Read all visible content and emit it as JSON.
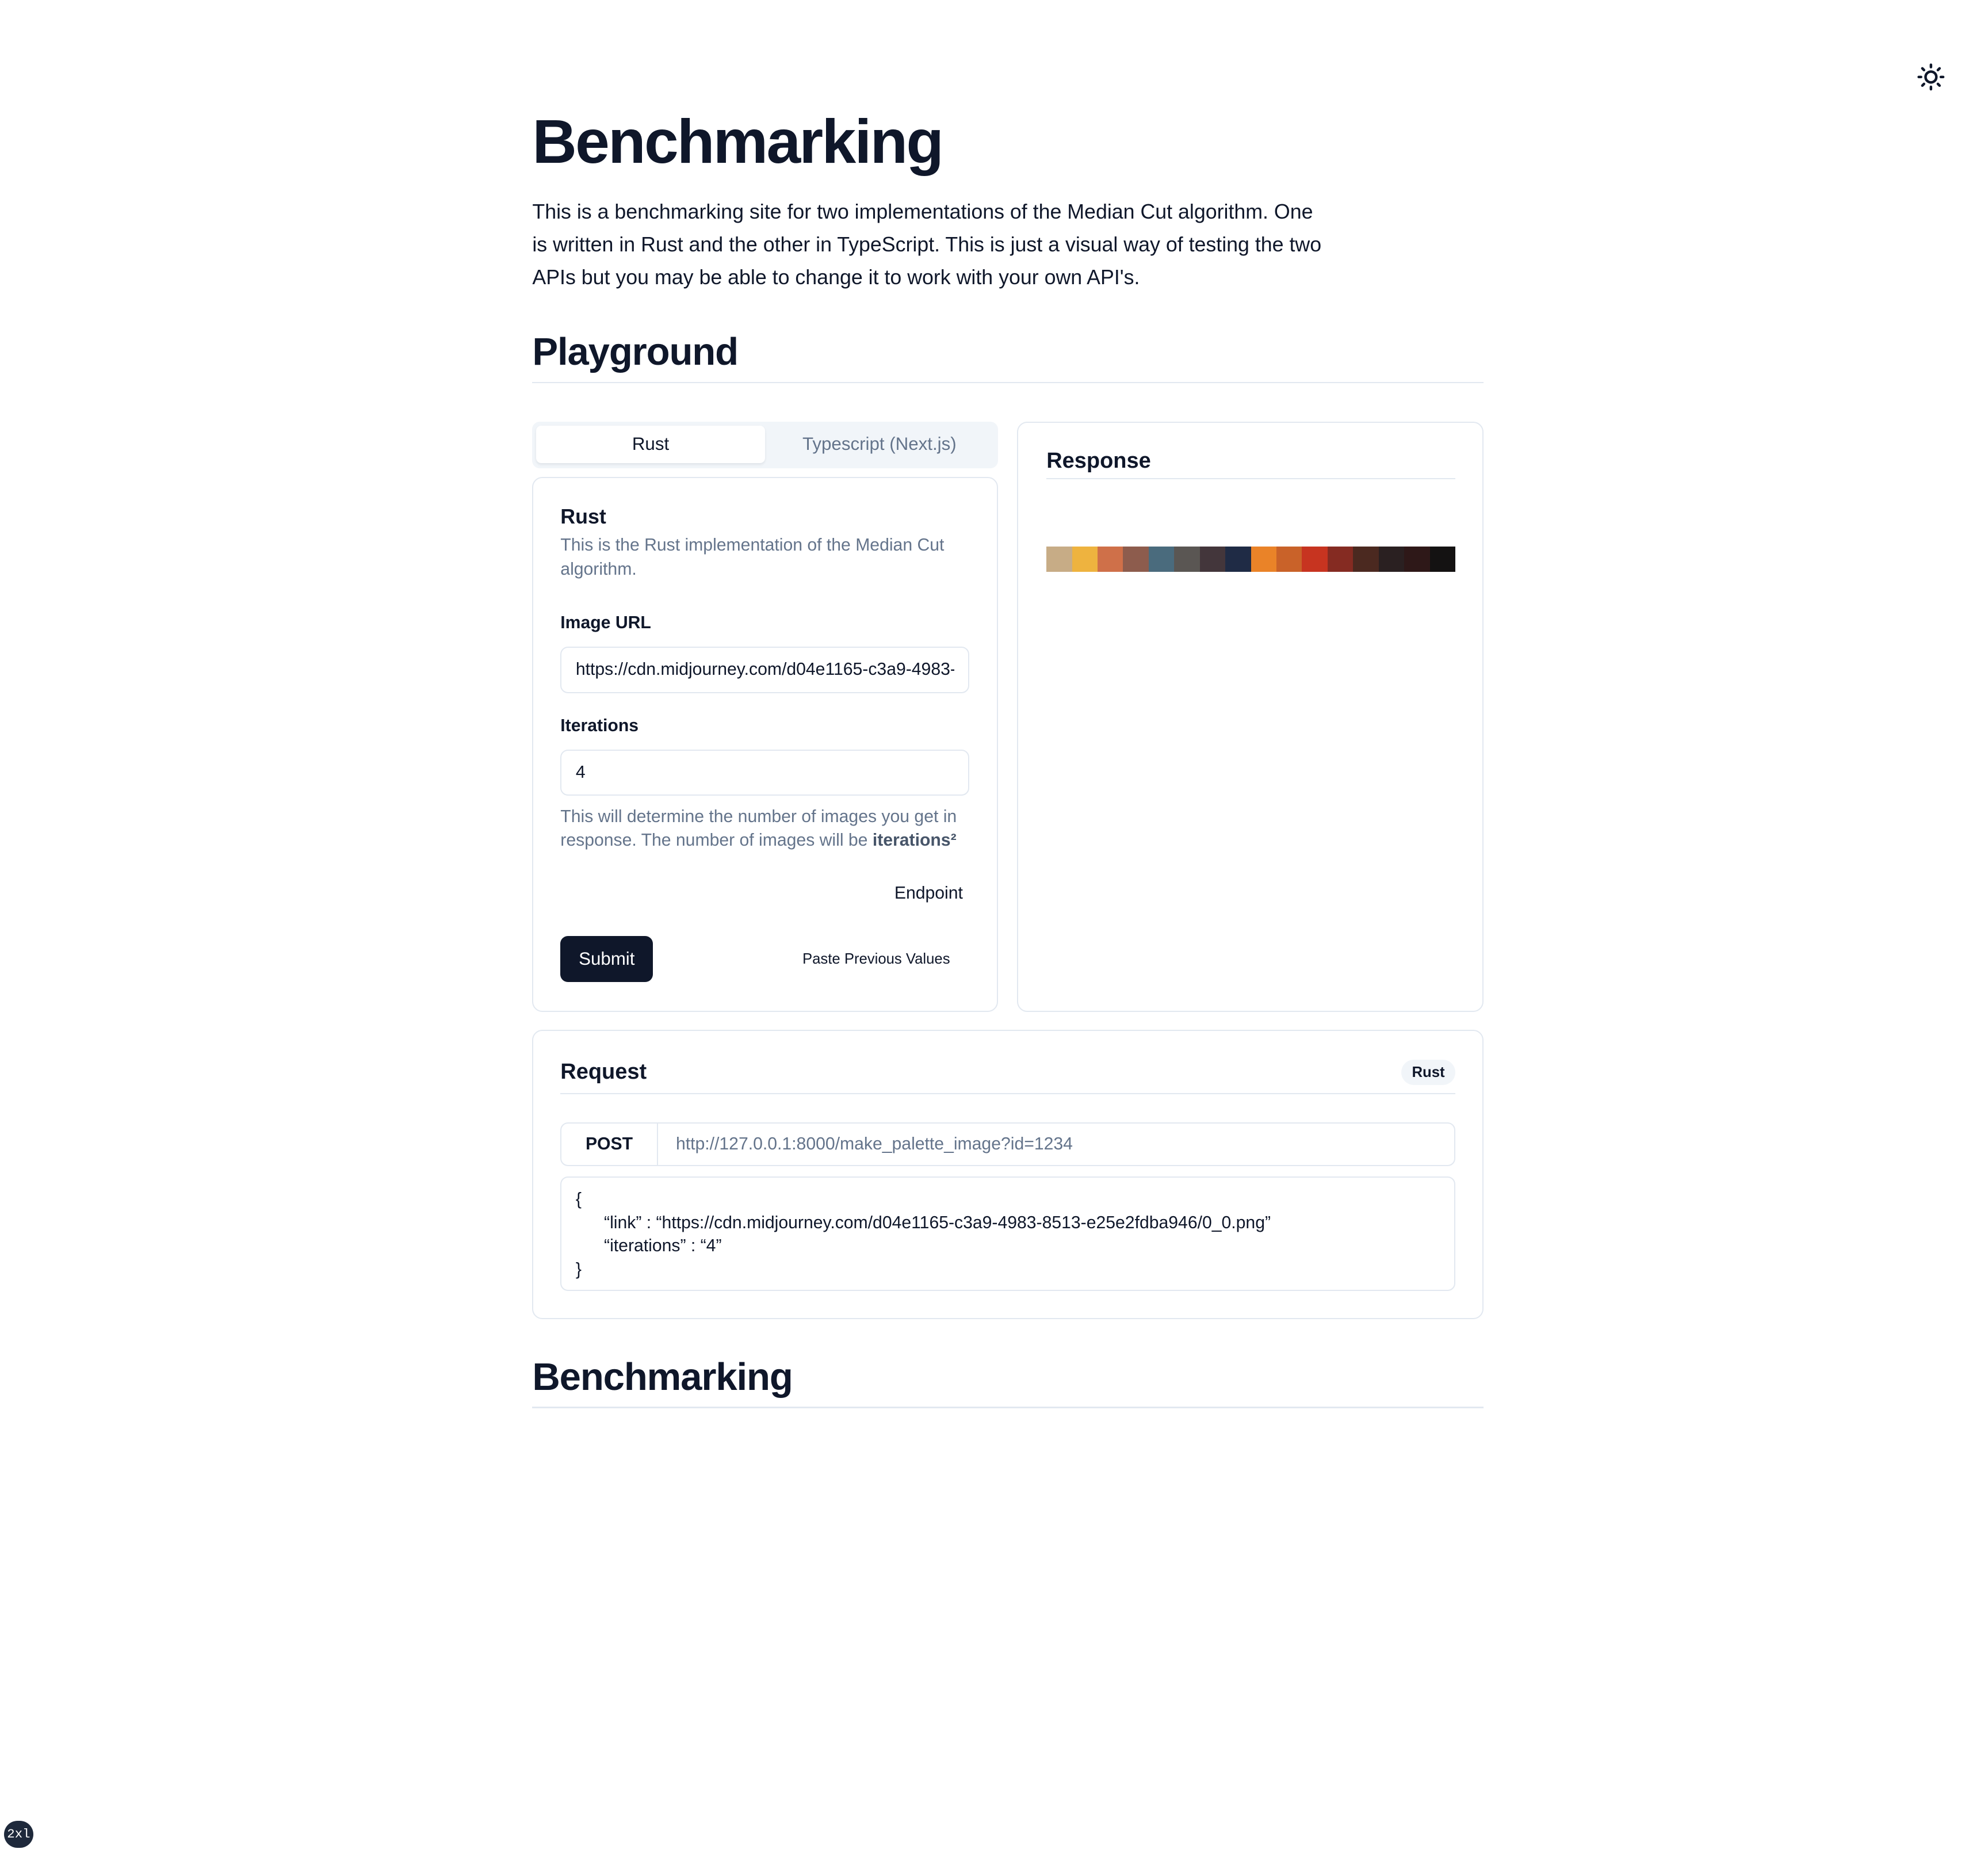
{
  "page": {
    "title": "Benchmarking",
    "intro": "This is a benchmarking site for two implementations of the Median Cut algorithm. One is written in Rust and the other in TypeScript. This is just a visual way of testing the two APIs but you may be able to change it to work with your own API's."
  },
  "theme_toggle": {
    "icon": "sun-icon"
  },
  "playground": {
    "heading": "Playground",
    "tabs": [
      {
        "label": "Rust",
        "active": true
      },
      {
        "label": "Typescript (Next.js)",
        "active": false
      }
    ],
    "form": {
      "title": "Rust",
      "description": "This is the Rust implementation of the Median Cut algorithm.",
      "image_url": {
        "label": "Image URL",
        "value": "https://cdn.midjourney.com/d04e1165-c3a9-4983-8513-e25e2fdba946/0_0.png"
      },
      "iterations": {
        "label": "Iterations",
        "value": "4",
        "hint_prefix": "This will determine the number of images you get in response. The number of images will be ",
        "hint_bold": "iterations²"
      },
      "endpoint_button": "Endpoint",
      "submit_button": "Submit",
      "paste_button": "Paste Previous Values"
    },
    "response": {
      "title": "Response",
      "palette": [
        "#c7ac86",
        "#eeb33f",
        "#cf7049",
        "#8d5c4d",
        "#4a6b7d",
        "#5a5653",
        "#43363b",
        "#1f2b45",
        "#ea8328",
        "#c96229",
        "#c73420",
        "#852b22",
        "#4b2920",
        "#2a2021",
        "#2e1818",
        "#141212"
      ]
    },
    "request": {
      "title": "Request",
      "badge": "Rust",
      "method": "POST",
      "url": "http://127.0.0.1:8000/make_palette_image?id=1234",
      "body": {
        "open": "{",
        "link_line": "“link” : “https://cdn.midjourney.com/d04e1165-c3a9-4983-8513-e25e2fdba946/0_0.png”",
        "iterations_line": "“iterations” : “4”",
        "close": "}"
      }
    }
  },
  "benchmarking": {
    "heading": "Benchmarking"
  },
  "screen_badge": "2xl",
  "colors": {
    "primary": "#0f172a",
    "muted_text": "#64748b",
    "border": "#e2e8f0",
    "tab_background": "#f1f5f9"
  }
}
